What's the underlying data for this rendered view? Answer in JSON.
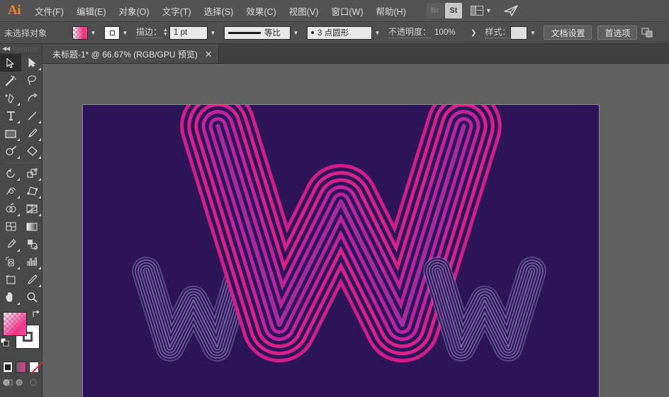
{
  "app": {
    "logo": "Ai",
    "name": "Adobe Illustrator"
  },
  "menubar": {
    "items": [
      {
        "label": "文件(F)",
        "text": "文件",
        "accel": "F"
      },
      {
        "label": "编辑(E)",
        "text": "编辑",
        "accel": "E"
      },
      {
        "label": "对象(O)",
        "text": "对象",
        "accel": "O"
      },
      {
        "label": "文字(T)",
        "text": "文字",
        "accel": "T"
      },
      {
        "label": "选择(S)",
        "text": "选择",
        "accel": "S"
      },
      {
        "label": "效果(C)",
        "text": "效果",
        "accel": "C"
      },
      {
        "label": "视图(V)",
        "text": "视图",
        "accel": "V"
      },
      {
        "label": "窗口(W)",
        "text": "窗口",
        "accel": "W"
      },
      {
        "label": "帮助(H)",
        "text": "帮助",
        "accel": "H"
      }
    ],
    "bridge_label": "Br",
    "stock_label": "St",
    "workspace_icon": "workspace-switcher-icon",
    "share_icon": "paper-plane-icon"
  },
  "controlbar": {
    "selection_status": "未选择对象",
    "fill_swatch": "gradient-pink",
    "stroke_swatch": "white",
    "stroke_label": "描边：",
    "stroke_weight": "1 pt",
    "profile_label": "等比",
    "brush_label": "3 点圆形",
    "opacity_label": "不透明度：",
    "opacity_value": "100%",
    "style_label": "样式：",
    "doc_setup_label": "文档设置",
    "preferences_label": "首选项",
    "arrange_icon": "arrange-documents-icon"
  },
  "tabbar": {
    "document_tab": "未标题-1* @ 66.67% (RGB/GPU 预览)",
    "close_glyph": "✕"
  },
  "toolpanel": {
    "tools": [
      {
        "name": "selection-tool",
        "active": true,
        "corner": false
      },
      {
        "name": "direct-selection-tool",
        "active": false,
        "corner": true
      },
      {
        "name": "magic-wand-tool",
        "active": false,
        "corner": false
      },
      {
        "name": "lasso-tool",
        "active": false,
        "corner": false
      },
      {
        "name": "pen-tool",
        "active": false,
        "corner": true
      },
      {
        "name": "curvature-tool",
        "active": false,
        "corner": false
      },
      {
        "name": "type-tool",
        "active": false,
        "corner": true
      },
      {
        "name": "line-segment-tool",
        "active": false,
        "corner": true
      },
      {
        "name": "rectangle-tool",
        "active": false,
        "corner": true
      },
      {
        "name": "paintbrush-tool",
        "active": false,
        "corner": true
      },
      {
        "name": "shaper-tool",
        "active": false,
        "corner": true
      },
      {
        "name": "eraser-tool",
        "active": false,
        "corner": true
      },
      {
        "name": "rotate-tool",
        "active": false,
        "corner": true
      },
      {
        "name": "scale-tool",
        "active": false,
        "corner": true
      },
      {
        "name": "width-tool",
        "active": false,
        "corner": true
      },
      {
        "name": "free-transform-tool",
        "active": false,
        "corner": true
      },
      {
        "name": "shape-builder-tool",
        "active": false,
        "corner": true
      },
      {
        "name": "perspective-grid-tool",
        "active": false,
        "corner": true
      },
      {
        "name": "mesh-tool",
        "active": false,
        "corner": false
      },
      {
        "name": "gradient-tool",
        "active": false,
        "corner": false
      },
      {
        "name": "eyedropper-tool",
        "active": false,
        "corner": true
      },
      {
        "name": "blend-tool",
        "active": false,
        "corner": false
      },
      {
        "name": "symbol-sprayer-tool",
        "active": false,
        "corner": true
      },
      {
        "name": "column-graph-tool",
        "active": false,
        "corner": true
      },
      {
        "name": "artboard-tool",
        "active": false,
        "corner": false
      },
      {
        "name": "slice-tool",
        "active": false,
        "corner": true
      },
      {
        "name": "hand-tool",
        "active": false,
        "corner": true
      },
      {
        "name": "zoom-tool",
        "active": false,
        "corner": false
      }
    ],
    "fill_name": "fill-swatch",
    "stroke_name": "stroke-swatch",
    "modes": [
      {
        "name": "color-mode-button"
      },
      {
        "name": "gradient-mode-button"
      },
      {
        "name": "none-mode-button"
      }
    ],
    "drawmodes": [
      {
        "name": "draw-normal-button"
      },
      {
        "name": "draw-behind-button"
      },
      {
        "name": "draw-inside-button"
      }
    ]
  },
  "canvas": {
    "background": "#616161",
    "artboard_color": "#2b1458",
    "artwork": {
      "description": "Three letter W shapes built from nested concentric rounded strokes",
      "letters": [
        {
          "name": "small-w-left",
          "color": "#7b68a8",
          "rings": 9,
          "opacity": 0.9
        },
        {
          "name": "large-w-center",
          "color": "#d6208a",
          "rings": 10,
          "opacity": 1.0
        },
        {
          "name": "small-w-right",
          "color": "#7b68a8",
          "rings": 9,
          "opacity": 0.9
        }
      ]
    }
  },
  "colors": {
    "accent_pink": "#ee2f7f",
    "artboard_purple": "#2b1458",
    "letter_magenta": "#d6208a",
    "letter_lavender": "#7b68a8",
    "chrome_gray": "#535353",
    "panel_gray": "#484848"
  }
}
